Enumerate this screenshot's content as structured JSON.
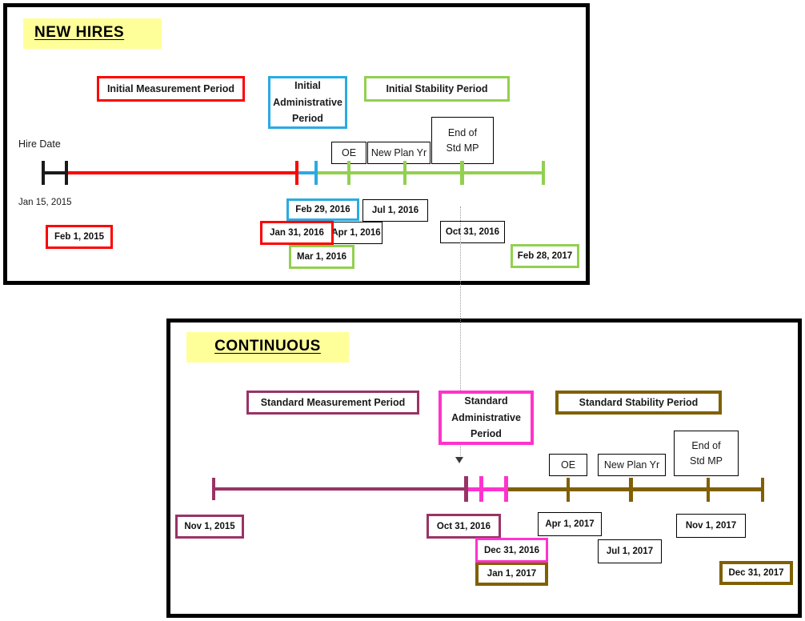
{
  "colors": {
    "panel_border": "#000000",
    "title_highlight": "#ffff99",
    "measurement_red": "#ff0000",
    "admin_blue": "#29abe2",
    "stability_green": "#92d050",
    "measurement_purple": "#993366",
    "admin_magenta": "#ff33cc",
    "stability_olive": "#806000",
    "hire_black": "#1a1a1a",
    "connector_gray": "#9a9a9a"
  },
  "new_hires": {
    "title": "NEW HIRES",
    "legend": [
      {
        "label": "Initial Measurement Period",
        "color": "#ff0000"
      },
      {
        "label": "Initial Administrative Period",
        "color": "#29abe2"
      },
      {
        "label": "Initial Stability Period",
        "color": "#92d050"
      }
    ],
    "hire_date_label": "Hire Date",
    "hire_date_value": "Jan 15, 2015",
    "markers": [
      {
        "label": "OE"
      },
      {
        "label": "New Plan Yr"
      },
      {
        "label": "End of Std MP"
      }
    ],
    "dates": [
      {
        "value": "Feb 1, 2015",
        "color": "#ff0000"
      },
      {
        "value": "Jan 31, 2016",
        "color": "#ff0000"
      },
      {
        "value": "Feb 29, 2016",
        "color": "#29abe2"
      },
      {
        "value": "Mar 1, 2016",
        "color": "#92d050"
      },
      {
        "value": "Apr 1, 2016",
        "color": "#000000"
      },
      {
        "value": "Jul 1, 2016",
        "color": "#000000"
      },
      {
        "value": "Oct 31, 2016",
        "color": "#000000"
      },
      {
        "value": "Feb 28, 2017",
        "color": "#92d050"
      }
    ]
  },
  "continuous": {
    "title": "CONTINUOUS",
    "legend": [
      {
        "label": "Standard Measurement Period",
        "color": "#993366"
      },
      {
        "label": "Standard Administrative Period",
        "color": "#ff33cc"
      },
      {
        "label": "Standard Stability Period",
        "color": "#806000"
      }
    ],
    "markers": [
      {
        "label": "OE"
      },
      {
        "label": "New Plan Yr"
      },
      {
        "label": "End of Std MP"
      }
    ],
    "dates": [
      {
        "value": "Nov 1, 2015",
        "color": "#993366"
      },
      {
        "value": "Oct 31, 2016",
        "color": "#993366"
      },
      {
        "value": "Dec 31, 2016",
        "color": "#ff33cc"
      },
      {
        "value": "Jan 1, 2017",
        "color": "#806000"
      },
      {
        "value": "Apr 1, 2017",
        "color": "#000000"
      },
      {
        "value": "Jul 1, 2017",
        "color": "#000000"
      },
      {
        "value": "Nov 1, 2017",
        "color": "#000000"
      },
      {
        "value": "Dec 31, 2017",
        "color": "#806000"
      }
    ]
  },
  "chart_data": {
    "type": "timeline",
    "title": "ACA Measurement / Administrative / Stability Period Timelines",
    "timelines": [
      {
        "name": "NEW HIRES",
        "start_label": "Hire Date",
        "start_date": "Jan 15, 2015",
        "segments": [
          {
            "name": "Hire Date",
            "color": "#1a1a1a",
            "start": "Jan 15, 2015",
            "end": "Feb 1, 2015"
          },
          {
            "name": "Initial Measurement Period",
            "color": "#ff0000",
            "start": "Feb 1, 2015",
            "end": "Jan 31, 2016"
          },
          {
            "name": "Initial Administrative Period",
            "color": "#29abe2",
            "start": "Feb 1, 2016",
            "end": "Feb 29, 2016"
          },
          {
            "name": "Initial Stability Period",
            "color": "#92d050",
            "start": "Mar 1, 2016",
            "end": "Feb 28, 2017"
          }
        ],
        "ticks": [
          {
            "date": "Jan 15, 2015",
            "label": "",
            "color": "#1a1a1a"
          },
          {
            "date": "Feb 1, 2015",
            "label": "",
            "color": "#1a1a1a"
          },
          {
            "date": "Jan 31, 2016",
            "label": "",
            "color": "#ff0000"
          },
          {
            "date": "Feb 29, 2016",
            "label": "",
            "color": "#29abe2"
          },
          {
            "date": "Apr 1, 2016",
            "label": "OE",
            "color": "#92d050"
          },
          {
            "date": "Jul 1, 2016",
            "label": "New Plan Yr",
            "color": "#92d050"
          },
          {
            "date": "Oct 31, 2016",
            "label": "End of Std MP",
            "color": "#92d050"
          },
          {
            "date": "Feb 28, 2017",
            "label": "",
            "color": "#92d050"
          }
        ]
      },
      {
        "name": "CONTINUOUS",
        "start_date": "Nov 1, 2015",
        "segments": [
          {
            "name": "Standard Measurement Period",
            "color": "#993366",
            "start": "Nov 1, 2015",
            "end": "Oct 31, 2016"
          },
          {
            "name": "Standard Administrative Period",
            "color": "#ff33cc",
            "start": "Nov 1, 2016",
            "end": "Dec 31, 2016"
          },
          {
            "name": "Standard Stability Period",
            "color": "#806000",
            "start": "Jan 1, 2017",
            "end": "Dec 31, 2017"
          }
        ],
        "ticks": [
          {
            "date": "Nov 1, 2015",
            "label": "",
            "color": "#993366"
          },
          {
            "date": "Oct 31, 2016",
            "label": "",
            "color": "#993366"
          },
          {
            "date": "Dec 31, 2016",
            "label": "",
            "color": "#ff33cc"
          },
          {
            "date": "Jan 1, 2017",
            "label": "",
            "color": "#ff33cc"
          },
          {
            "date": "Apr 1, 2017",
            "label": "OE",
            "color": "#806000"
          },
          {
            "date": "Jul 1, 2017",
            "label": "New Plan Yr",
            "color": "#806000"
          },
          {
            "date": "Nov 1, 2017",
            "label": "End of Std MP",
            "color": "#806000"
          },
          {
            "date": "Dec 31, 2017",
            "label": "",
            "color": "#806000"
          }
        ]
      }
    ],
    "connector": {
      "from": "NEW HIRES / Oct 31, 2016 (End of Std MP)",
      "to": "CONTINUOUS / Oct 31, 2016 (end of Standard Measurement Period)",
      "style": "dotted-arrow"
    }
  }
}
